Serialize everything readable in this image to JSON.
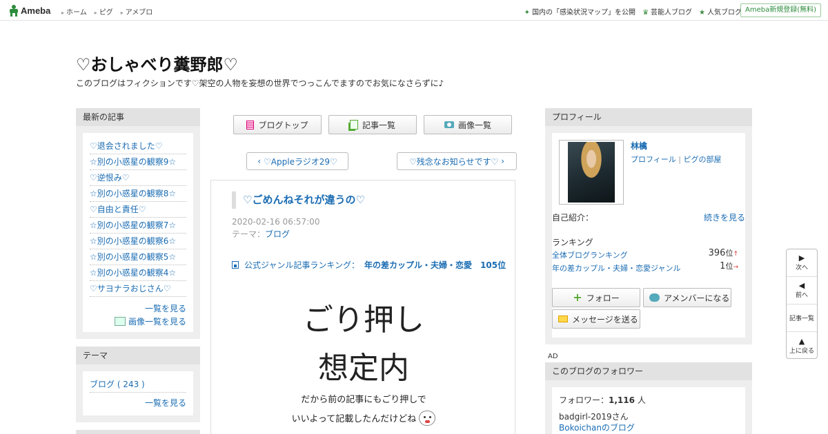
{
  "topbar": {
    "logo": "Ameba",
    "nav": [
      "ホーム",
      "ピグ",
      "アメブロ"
    ],
    "links": [
      "国内の「感染状況マップ」を公開",
      "芸能人ブログ",
      "人気ブログ"
    ],
    "signup": "Ameba新規登録(無料)"
  },
  "blog": {
    "title": "♡おしゃべり糞野郎♡",
    "description": "このブログはフィクションです♡架空の人物を妄想の世界でつっこんでますのでお気になさらずに♪"
  },
  "recent": {
    "heading": "最新の記事",
    "items": [
      "♡退会されました♡",
      "☆別の小惑星の観察9☆",
      "♡逆恨み♡",
      "☆別の小惑星の観察8☆",
      "♡自由と責任♡",
      "☆別の小惑星の観察7☆",
      "☆別の小惑星の観察6☆",
      "☆別の小惑星の観察5☆",
      "☆別の小惑星の観察4☆",
      "♡サヨナラおじさん♡"
    ],
    "list_link": "一覧を見る",
    "image_link": "画像一覧を見る"
  },
  "theme": {
    "heading": "テーマ",
    "item": "ブログ ( 243 )",
    "list_link": "一覧を見る"
  },
  "center_nav": {
    "top": "ブログトップ",
    "entries": "記事一覧",
    "images": "画像一覧"
  },
  "pager": {
    "prev": "♡Appleラジオ29♡",
    "next": "♡残念なお知らせです♡"
  },
  "article": {
    "title": "♡ごめんねそれが違うの♡",
    "date": "2020-02-16 06:57:00",
    "theme_label": "テーマ：",
    "theme": "ブログ",
    "rank_label": "公式ジャンル記事ランキング：",
    "rank_genre": "年の差カップル・夫婦・恋愛",
    "rank_value": "105位",
    "big1": "ごり押し",
    "big2": "想定内",
    "line1": "だから前の記事にもごり押しで",
    "line2": "いいよって記載したんだけどね"
  },
  "profile": {
    "heading": "プロフィール",
    "name": "林檎",
    "profile_link": "プロフィール",
    "pig_link": "ピグの部屋",
    "intro_label": "自己紹介：",
    "intro_more": "続きを見る",
    "ranking_label": "ランキング",
    "rank1_label": "全体ブログランキング",
    "rank1_value": "396",
    "rank1_unit": "位",
    "rank1_trend": "↑",
    "rank2_label": "年の差カップル・夫婦・恋愛ジャンル",
    "rank2_value": "1",
    "rank2_unit": "位",
    "rank2_trend": "→",
    "follow": "フォロー",
    "member": "アメンバーになる",
    "message": "メッセージを送る"
  },
  "ad_label": "AD",
  "followers": {
    "heading": "このブログのフォロワー",
    "count_label": "フォロワー：",
    "count": "1,116",
    "count_unit": "人",
    "follower1": "badgirl-2019さん",
    "follower2": "Bokoichanのブログ"
  },
  "floatnav": {
    "next": "次へ",
    "prev": "前へ",
    "list": "記事一覧",
    "top": "上に戻る"
  }
}
